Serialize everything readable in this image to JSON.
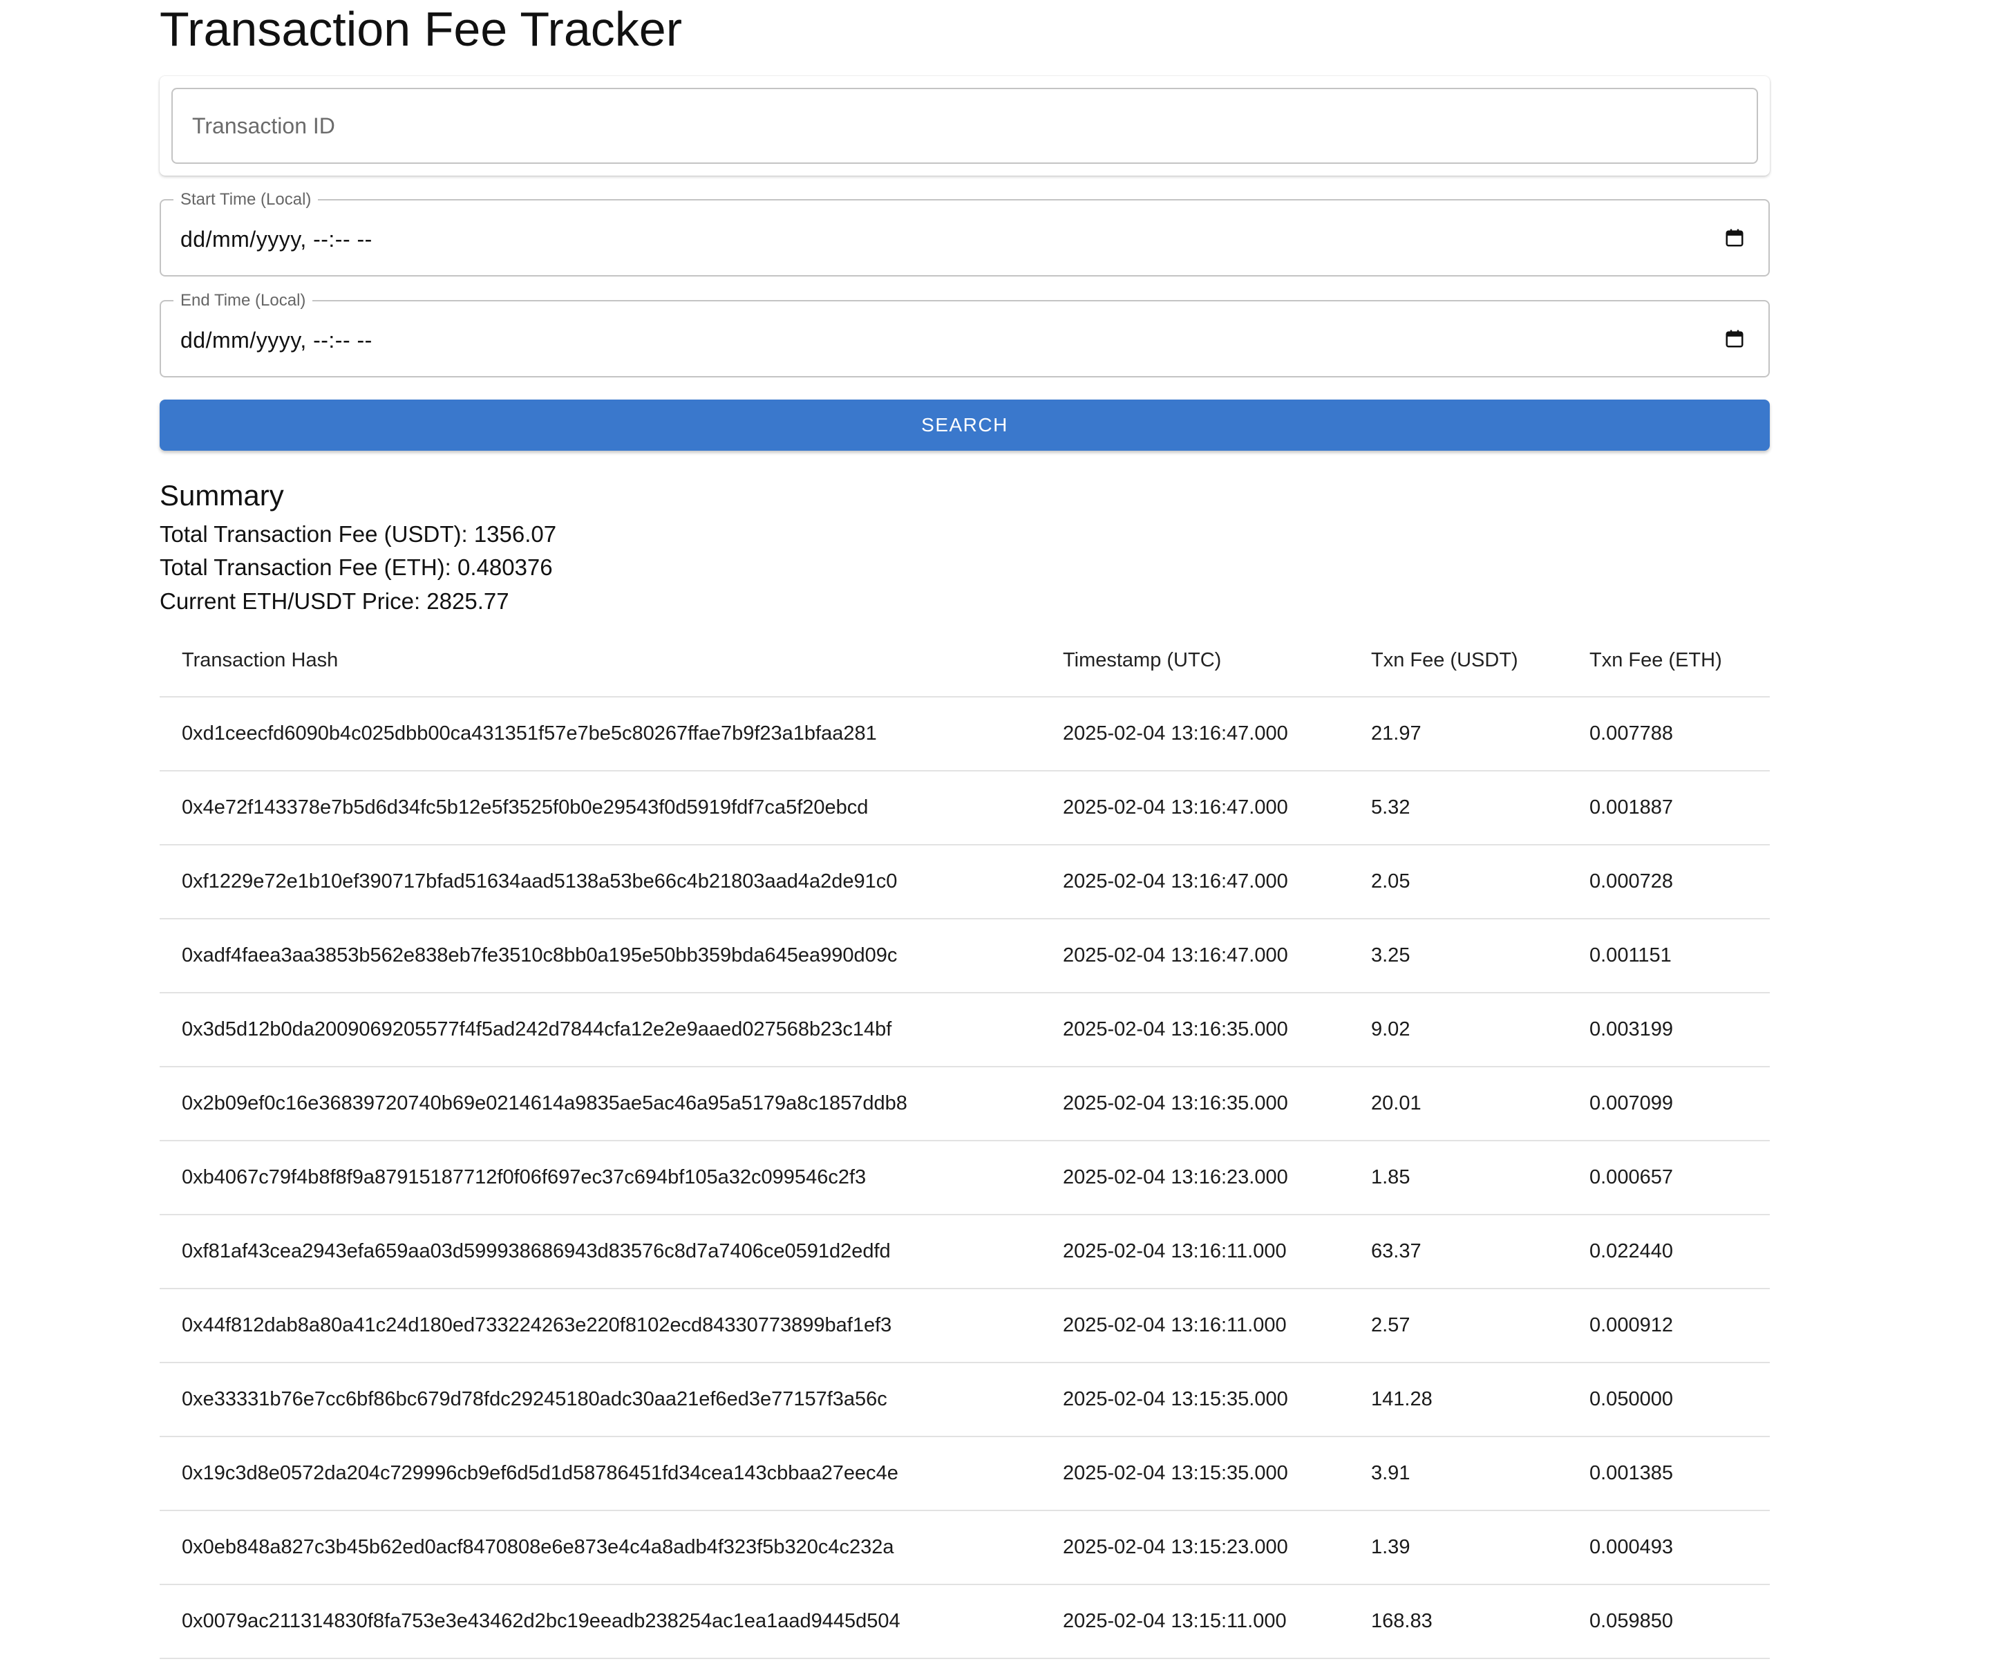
{
  "page": {
    "title": "Transaction Fee Tracker"
  },
  "search_form": {
    "transaction_id": {
      "placeholder": "Transaction ID",
      "value": ""
    },
    "start_time": {
      "label": "Start Time (Local)",
      "value": "dd/mm/yyyy, --:-- --"
    },
    "end_time": {
      "label": "End Time (Local)",
      "value": "dd/mm/yyyy, --:-- --"
    },
    "search_button_label": "SEARCH",
    "calendar_icon": "calendar-icon"
  },
  "summary": {
    "title": "Summary",
    "total_fee_usdt": "Total Transaction Fee (USDT): 1356.07",
    "total_fee_eth": "Total Transaction Fee (ETH): 0.480376",
    "eth_usdt_price": "Current ETH/USDT Price: 2825.77"
  },
  "table": {
    "headers": [
      "Transaction Hash",
      "Timestamp (UTC)",
      "Txn Fee (USDT)",
      "Txn Fee (ETH)"
    ],
    "rows": [
      {
        "hash": "0xd1ceecfd6090b4c025dbb00ca431351f57e7be5c80267ffae7b9f23a1bfaa281",
        "timestamp": "2025-02-04 13:16:47.000",
        "fee_usdt": "21.97",
        "fee_eth": "0.007788"
      },
      {
        "hash": "0x4e72f143378e7b5d6d34fc5b12e5f3525f0b0e29543f0d5919fdf7ca5f20ebcd",
        "timestamp": "2025-02-04 13:16:47.000",
        "fee_usdt": "5.32",
        "fee_eth": "0.001887"
      },
      {
        "hash": "0xf1229e72e1b10ef390717bfad51634aad5138a53be66c4b21803aad4a2de91c0",
        "timestamp": "2025-02-04 13:16:47.000",
        "fee_usdt": "2.05",
        "fee_eth": "0.000728"
      },
      {
        "hash": "0xadf4faea3aa3853b562e838eb7fe3510c8bb0a195e50bb359bda645ea990d09c",
        "timestamp": "2025-02-04 13:16:47.000",
        "fee_usdt": "3.25",
        "fee_eth": "0.001151"
      },
      {
        "hash": "0x3d5d12b0da2009069205577f4f5ad242d7844cfa12e2e9aaed027568b23c14bf",
        "timestamp": "2025-02-04 13:16:35.000",
        "fee_usdt": "9.02",
        "fee_eth": "0.003199"
      },
      {
        "hash": "0x2b09ef0c16e36839720740b69e0214614a9835ae5ac46a95a5179a8c1857ddb8",
        "timestamp": "2025-02-04 13:16:35.000",
        "fee_usdt": "20.01",
        "fee_eth": "0.007099"
      },
      {
        "hash": "0xb4067c79f4b8f8f9a87915187712f0f06f697ec37c694bf105a32c099546c2f3",
        "timestamp": "2025-02-04 13:16:23.000",
        "fee_usdt": "1.85",
        "fee_eth": "0.000657"
      },
      {
        "hash": "0xf81af43cea2943efa659aa03d599938686943d83576c8d7a7406ce0591d2edfd",
        "timestamp": "2025-02-04 13:16:11.000",
        "fee_usdt": "63.37",
        "fee_eth": "0.022440"
      },
      {
        "hash": "0x44f812dab8a80a41c24d180ed733224263e220f8102ecd84330773899baf1ef3",
        "timestamp": "2025-02-04 13:16:11.000",
        "fee_usdt": "2.57",
        "fee_eth": "0.000912"
      },
      {
        "hash": "0xe33331b76e7cc6bf86bc679d78fdc29245180adc30aa21ef6ed3e77157f3a56c",
        "timestamp": "2025-02-04 13:15:35.000",
        "fee_usdt": "141.28",
        "fee_eth": "0.050000"
      },
      {
        "hash": "0x19c3d8e0572da204c729996cb9ef6d5d1d58786451fd34cea143cbbaa27eec4e",
        "timestamp": "2025-02-04 13:15:35.000",
        "fee_usdt": "3.91",
        "fee_eth": "0.001385"
      },
      {
        "hash": "0x0eb848a827c3b45b62ed0acf8470808e6e873e4c4a8adb4f323f5b320c4c232a",
        "timestamp": "2025-02-04 13:15:23.000",
        "fee_usdt": "1.39",
        "fee_eth": "0.000493"
      },
      {
        "hash": "0x0079ac211314830f8fa753e3e43462d2bc19eeadb238254ac1ea1aad9445d504",
        "timestamp": "2025-02-04 13:15:11.000",
        "fee_usdt": "168.83",
        "fee_eth": "0.059850"
      }
    ]
  },
  "colors": {
    "primary": "#3a78cc",
    "border": "#c4c4c4",
    "divider": "#e2e2e2",
    "text": "#111111"
  }
}
